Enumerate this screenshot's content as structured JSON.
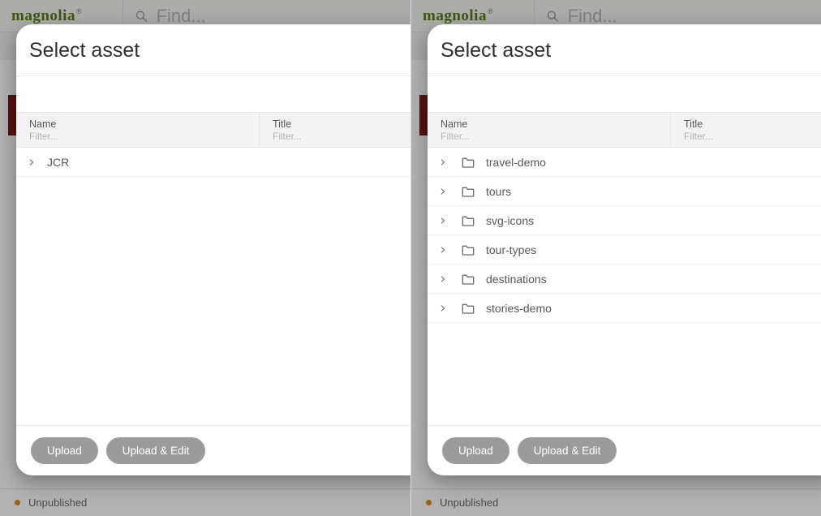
{
  "brand": "magnolia",
  "search_placeholder": "Find...",
  "status": {
    "label": "Unpublished"
  },
  "dialog": {
    "title": "Select asset",
    "columns": {
      "name": "Name",
      "title": "Title"
    },
    "filter_placeholder": "Filter...",
    "buttons": {
      "upload": "Upload",
      "upload_edit": "Upload & Edit"
    }
  },
  "panes": [
    {
      "rows": [
        {
          "name": "JCR",
          "has_folder": false
        }
      ]
    },
    {
      "rows": [
        {
          "name": "travel-demo",
          "has_folder": true
        },
        {
          "name": "tours",
          "has_folder": true
        },
        {
          "name": "svg-icons",
          "has_folder": true
        },
        {
          "name": "tour-types",
          "has_folder": true
        },
        {
          "name": "destinations",
          "has_folder": true
        },
        {
          "name": "stories-demo",
          "has_folder": true
        }
      ]
    }
  ]
}
